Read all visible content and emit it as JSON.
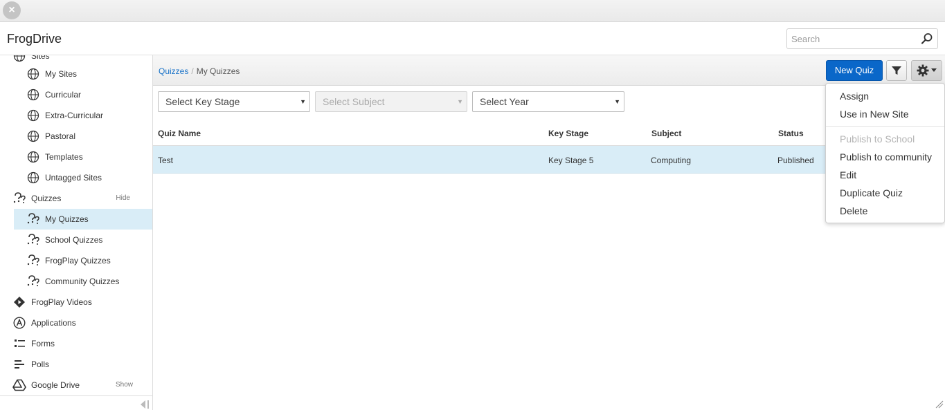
{
  "window": {
    "close_label": "×"
  },
  "app": {
    "title": "FrogDrive"
  },
  "search": {
    "placeholder": "Search"
  },
  "sidebar": {
    "items": [
      {
        "label": "Sites",
        "icon": "globe-icon"
      },
      {
        "label": "My Sites",
        "icon": "globe-icon"
      },
      {
        "label": "Curricular",
        "icon": "globe-icon"
      },
      {
        "label": "Extra-Curricular",
        "icon": "globe-icon"
      },
      {
        "label": "Pastoral",
        "icon": "globe-icon"
      },
      {
        "label": "Templates",
        "icon": "globe-icon"
      },
      {
        "label": "Untagged Sites",
        "icon": "globe-icon"
      },
      {
        "label": "Quizzes",
        "icon": "quiz-icon",
        "action": "Hide"
      },
      {
        "label": "My Quizzes",
        "icon": "quiz-icon",
        "selected": true
      },
      {
        "label": "School Quizzes",
        "icon": "quiz-icon"
      },
      {
        "label": "FrogPlay Quizzes",
        "icon": "quiz-icon"
      },
      {
        "label": "Community Quizzes",
        "icon": "quiz-icon"
      },
      {
        "label": "FrogPlay Videos",
        "icon": "video-icon"
      },
      {
        "label": "Applications",
        "icon": "applications-icon"
      },
      {
        "label": "Forms",
        "icon": "forms-icon"
      },
      {
        "label": "Polls",
        "icon": "polls-icon"
      },
      {
        "label": "Google Drive",
        "icon": "google-drive-icon",
        "action": "Show"
      }
    ]
  },
  "breadcrumb": {
    "root": "Quizzes",
    "separator": "/",
    "current": "My Quizzes"
  },
  "toolbar": {
    "new_quiz_label": "New Quiz"
  },
  "filters": {
    "key_stage": "Select Key Stage",
    "subject": "Select Subject",
    "year": "Select Year",
    "arrow": "▼"
  },
  "table": {
    "headers": {
      "name": "Quiz Name",
      "key_stage": "Key Stage",
      "subject": "Subject",
      "status": "Status"
    },
    "rows": [
      {
        "name": "Test",
        "key_stage": "Key Stage 5",
        "subject": "Computing",
        "status": "Published"
      }
    ]
  },
  "menu": {
    "items": [
      {
        "label": "Assign"
      },
      {
        "label": "Use in New Site"
      },
      {
        "label": "Publish to School",
        "disabled": true
      },
      {
        "label": "Publish to community"
      },
      {
        "label": "Edit"
      },
      {
        "label": "Duplicate Quiz"
      },
      {
        "label": "Delete"
      }
    ]
  },
  "colors": {
    "accent": "#0a67c9",
    "selected_bg": "#d9edf7",
    "link": "#1a73c8"
  }
}
